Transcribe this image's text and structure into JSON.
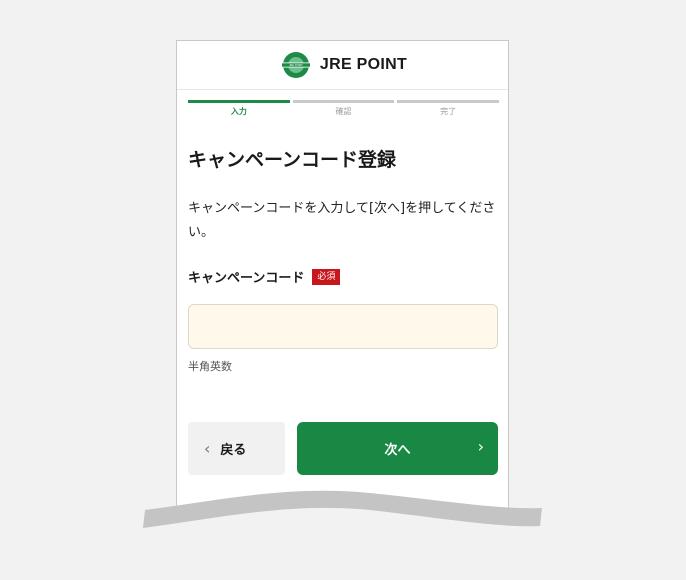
{
  "logo": {
    "text": "JRE POINT",
    "mark_label": "JRE POINT"
  },
  "steps": [
    {
      "label": "入力",
      "active": true
    },
    {
      "label": "確認",
      "active": false
    },
    {
      "label": "完了",
      "active": false
    }
  ],
  "page": {
    "title": "キャンペーンコード登録",
    "description": "キャンペーンコードを入力して[次へ]を押してください。"
  },
  "form": {
    "label": "キャンペーンコード",
    "required_badge": "必須",
    "input_value": "",
    "hint": "半角英数"
  },
  "buttons": {
    "back_label": "戻る",
    "next_label": "次へ"
  },
  "colors": {
    "brand_green": "#1a8845",
    "required_red": "#c8161d",
    "input_bg": "#fef9ea",
    "step_inactive": "#c9c9c9"
  },
  "icons": {
    "back": "chevron-left-icon",
    "next": "chevron-right-icon",
    "logo": "jre-point-logo-icon"
  }
}
